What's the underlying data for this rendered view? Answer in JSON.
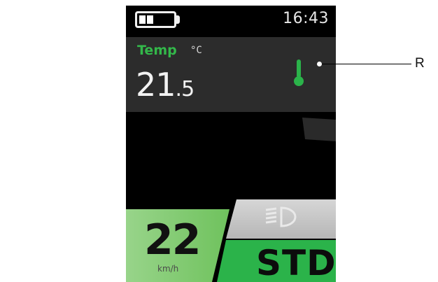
{
  "status_bar": {
    "battery_level": 0.4,
    "time": "16:43"
  },
  "temperature": {
    "label": "Temp",
    "unit": "°C",
    "value_int": "21",
    "value_dec": ".5",
    "icon": "thermometer-icon"
  },
  "ride": {
    "speed": "22",
    "speed_unit": "km/h",
    "mode": "STD",
    "light_icon": "headlight-icon"
  },
  "callout": {
    "letter": "R"
  },
  "colors": {
    "accent_green": "#2bb34a",
    "speed_panel_green": "#8fd17a",
    "panel_dark": "#2c2c2c"
  }
}
